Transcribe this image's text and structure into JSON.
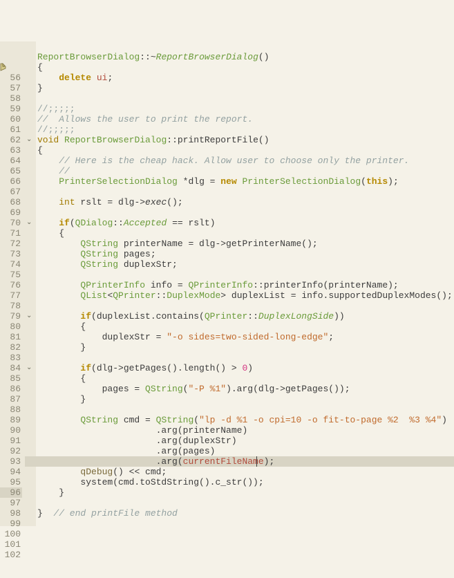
{
  "lineStart": 56,
  "lineEnd": 102,
  "currentLine": 96,
  "foldMarkers": [
    65,
    73,
    82,
    87
  ],
  "breakpointLine": 58,
  "tokens": {
    "56": [],
    "57": [
      {
        "t": "ReportBrowserDialog",
        "c": "k-class"
      },
      {
        "t": "::",
        "c": "k-punct"
      },
      {
        "t": "~",
        "c": "k-punct"
      },
      {
        "t": "ReportBrowserDialog",
        "c": "k-class-i"
      },
      {
        "t": "()",
        "c": "k-punct"
      }
    ],
    "58": [
      {
        "t": "{",
        "c": "k-punct"
      }
    ],
    "59": [
      {
        "t": "    ",
        "c": ""
      },
      {
        "t": "delete",
        "c": "k-kw"
      },
      {
        "t": " ",
        "c": ""
      },
      {
        "t": "ui",
        "c": "k-mem"
      },
      {
        "t": ";",
        "c": "k-punct"
      }
    ],
    "60": [
      {
        "t": "}",
        "c": "k-punct"
      }
    ],
    "61": [],
    "62": [
      {
        "t": "//;;;;;",
        "c": "k-cmt2"
      }
    ],
    "63": [
      {
        "t": "//  Allows the user to print the report.",
        "c": "k-cmt"
      }
    ],
    "64": [
      {
        "t": "//;;;;;",
        "c": "k-cmt2"
      }
    ],
    "65": [
      {
        "t": "void",
        "c": "k-type"
      },
      {
        "t": " ",
        "c": ""
      },
      {
        "t": "ReportBrowserDialog",
        "c": "k-class"
      },
      {
        "t": "::",
        "c": "k-punct"
      },
      {
        "t": "printReportFile()",
        "c": "k-func"
      }
    ],
    "66": [
      {
        "t": "{",
        "c": "k-punct"
      }
    ],
    "67": [
      {
        "t": "    ",
        "c": ""
      },
      {
        "t": "// Here is the cheap hack. Allow user to choose only the printer.",
        "c": "k-cmt"
      }
    ],
    "68": [
      {
        "t": "    ",
        "c": ""
      },
      {
        "t": "//",
        "c": "k-cmt"
      }
    ],
    "69": [
      {
        "t": "    ",
        "c": ""
      },
      {
        "t": "PrinterSelectionDialog",
        "c": "k-class"
      },
      {
        "t": " *dlg = ",
        "c": "k-ident"
      },
      {
        "t": "new",
        "c": "k-kw"
      },
      {
        "t": " ",
        "c": ""
      },
      {
        "t": "PrinterSelectionDialog",
        "c": "k-class"
      },
      {
        "t": "(",
        "c": "k-punct"
      },
      {
        "t": "this",
        "c": "k-kw"
      },
      {
        "t": ");",
        "c": "k-punct"
      }
    ],
    "70": [],
    "71": [
      {
        "t": "    ",
        "c": ""
      },
      {
        "t": "int",
        "c": "k-type"
      },
      {
        "t": " rslt = dlg->",
        "c": "k-ident"
      },
      {
        "t": "exec",
        "c": "k-ident-i"
      },
      {
        "t": "();",
        "c": "k-punct"
      }
    ],
    "72": [],
    "73": [
      {
        "t": "    ",
        "c": ""
      },
      {
        "t": "if",
        "c": "k-kw"
      },
      {
        "t": "(",
        "c": "k-punct"
      },
      {
        "t": "QDialog",
        "c": "k-class"
      },
      {
        "t": "::",
        "c": "k-punct"
      },
      {
        "t": "Accepted",
        "c": "k-enum"
      },
      {
        "t": " == rslt)",
        "c": "k-ident"
      }
    ],
    "74": [
      {
        "t": "    {",
        "c": "k-punct"
      }
    ],
    "75": [
      {
        "t": "        ",
        "c": ""
      },
      {
        "t": "QString",
        "c": "k-class"
      },
      {
        "t": " printerName = dlg->getPrinterName();",
        "c": "k-ident"
      }
    ],
    "76": [
      {
        "t": "        ",
        "c": ""
      },
      {
        "t": "QString",
        "c": "k-class"
      },
      {
        "t": " pages;",
        "c": "k-ident"
      }
    ],
    "77": [
      {
        "t": "        ",
        "c": ""
      },
      {
        "t": "QString",
        "c": "k-class"
      },
      {
        "t": " duplexStr;",
        "c": "k-ident"
      }
    ],
    "78": [],
    "79": [
      {
        "t": "        ",
        "c": ""
      },
      {
        "t": "QPrinterInfo",
        "c": "k-class"
      },
      {
        "t": " info = ",
        "c": "k-ident"
      },
      {
        "t": "QPrinterInfo",
        "c": "k-class"
      },
      {
        "t": "::printerInfo(printerName);",
        "c": "k-ident"
      }
    ],
    "80": [
      {
        "t": "        ",
        "c": ""
      },
      {
        "t": "QList",
        "c": "k-class"
      },
      {
        "t": "<",
        "c": "k-punct"
      },
      {
        "t": "QPrinter",
        "c": "k-class"
      },
      {
        "t": "::",
        "c": "k-punct"
      },
      {
        "t": "DuplexMode",
        "c": "k-class"
      },
      {
        "t": "> duplexList = info.supportedDuplexModes();",
        "c": "k-ident"
      }
    ],
    "81": [],
    "82": [
      {
        "t": "        ",
        "c": ""
      },
      {
        "t": "if",
        "c": "k-kw"
      },
      {
        "t": "(duplexList.contains(",
        "c": "k-ident"
      },
      {
        "t": "QPrinter",
        "c": "k-class"
      },
      {
        "t": "::",
        "c": "k-punct"
      },
      {
        "t": "DuplexLongSide",
        "c": "k-enum"
      },
      {
        "t": "))",
        "c": "k-ident"
      }
    ],
    "83": [
      {
        "t": "        {",
        "c": "k-punct"
      }
    ],
    "84": [
      {
        "t": "            duplexStr = ",
        "c": "k-ident"
      },
      {
        "t": "\"-o sides=two-sided-long-edge\"",
        "c": "k-str"
      },
      {
        "t": ";",
        "c": "k-punct"
      }
    ],
    "85": [
      {
        "t": "        }",
        "c": "k-punct"
      }
    ],
    "86": [],
    "87": [
      {
        "t": "        ",
        "c": ""
      },
      {
        "t": "if",
        "c": "k-kw"
      },
      {
        "t": "(dlg->getPages().length() > ",
        "c": "k-ident"
      },
      {
        "t": "0",
        "c": "k-num"
      },
      {
        "t": ")",
        "c": "k-ident"
      }
    ],
    "88": [
      {
        "t": "        {",
        "c": "k-punct"
      }
    ],
    "89": [
      {
        "t": "            pages = ",
        "c": "k-ident"
      },
      {
        "t": "QString",
        "c": "k-class"
      },
      {
        "t": "(",
        "c": "k-punct"
      },
      {
        "t": "\"-P %1\"",
        "c": "k-str"
      },
      {
        "t": ").arg(dlg->getPages());",
        "c": "k-ident"
      }
    ],
    "90": [
      {
        "t": "        }",
        "c": "k-punct"
      }
    ],
    "91": [],
    "92": [
      {
        "t": "        ",
        "c": ""
      },
      {
        "t": "QString",
        "c": "k-class"
      },
      {
        "t": " cmd = ",
        "c": "k-ident"
      },
      {
        "t": "QString",
        "c": "k-class"
      },
      {
        "t": "(",
        "c": "k-punct"
      },
      {
        "t": "\"lp -d %1 -o cpi=10 -o fit-to-page %2  %3 %4\"",
        "c": "k-str"
      },
      {
        "t": ")",
        "c": "k-ident"
      }
    ],
    "93": [
      {
        "t": "                      .arg(printerName)",
        "c": "k-ident"
      }
    ],
    "94": [
      {
        "t": "                      .arg(duplexStr)",
        "c": "k-ident"
      }
    ],
    "95": [
      {
        "t": "                      .arg(pages)",
        "c": "k-ident"
      }
    ],
    "96": [
      {
        "t": "                      .arg(",
        "c": "k-ident"
      },
      {
        "t": "currentFileName",
        "c": "k-mem"
      },
      {
        "t": ");",
        "c": "k-ident"
      }
    ],
    "97": [
      {
        "t": "        ",
        "c": ""
      },
      {
        "t": "qDebug",
        "c": "k-qdebug"
      },
      {
        "t": "() << cmd;",
        "c": "k-ident"
      }
    ],
    "98": [
      {
        "t": "        system(cmd.toStdString().c_str());",
        "c": "k-ident"
      }
    ],
    "99": [
      {
        "t": "    }",
        "c": "k-punct"
      }
    ],
    "100": [],
    "101": [
      {
        "t": "}  ",
        "c": "k-punct"
      },
      {
        "t": "// end printFile method",
        "c": "k-cmt"
      }
    ],
    "102": []
  },
  "caret": {
    "line": 96,
    "col": 47
  }
}
